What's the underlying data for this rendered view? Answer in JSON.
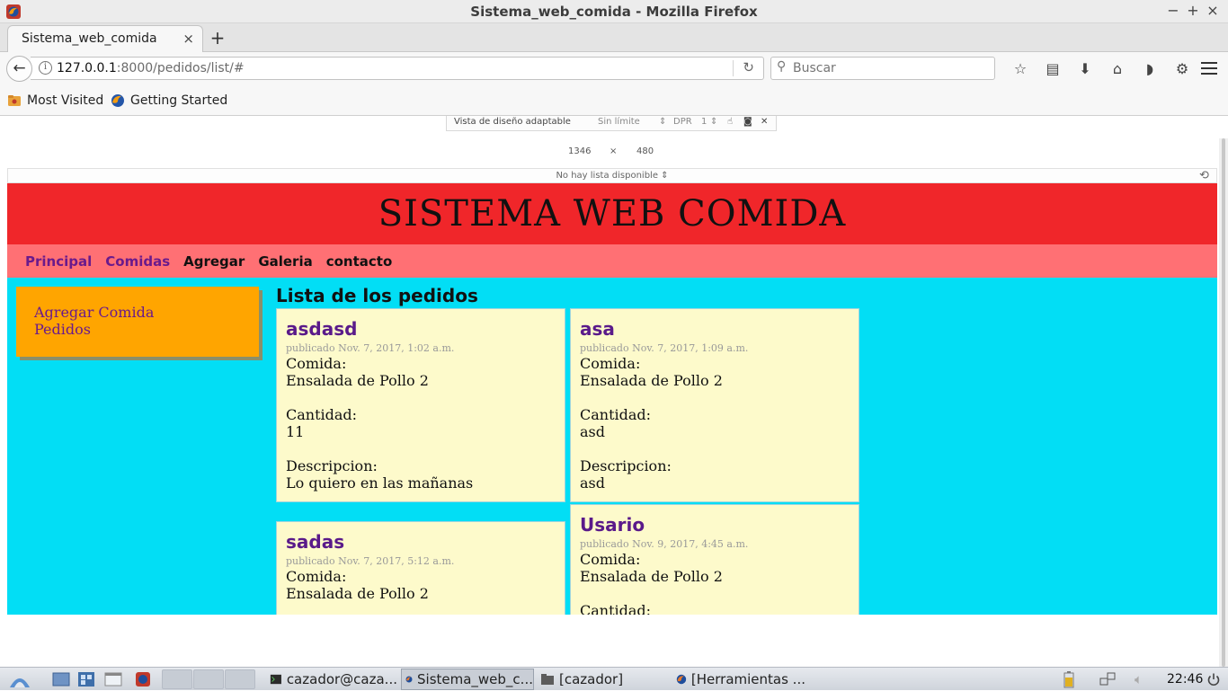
{
  "window": {
    "title": "Sistema_web_comida - Mozilla Firefox",
    "buttons": {
      "minimize": "−",
      "maximize": "+",
      "close": "×"
    }
  },
  "tab": {
    "label": "Sistema_web_comida",
    "close": "×",
    "new_tab": "+"
  },
  "urlbar": {
    "host": "127.0.0.1",
    "path": ":8000/pedidos/list/#"
  },
  "search": {
    "placeholder": "Buscar"
  },
  "bookmarks": [
    {
      "label": "Most Visited",
      "icon": "folder-icon"
    },
    {
      "label": "Getting Started",
      "icon": "firefox-icon"
    }
  ],
  "rdm": {
    "label": "Vista de diseño adaptable",
    "size_preset": "Sin límite",
    "dpr_label": "DPR",
    "dpr_value": "1",
    "width": "1346",
    "times": "×",
    "height": "480",
    "device": "No hay lista disponible"
  },
  "site": {
    "title": "SISTEMA WEB COMIDA",
    "nav": [
      {
        "label": "Principal",
        "style": "visited"
      },
      {
        "label": "Comidas",
        "style": "visited"
      },
      {
        "label": "Agregar",
        "style": "plain"
      },
      {
        "label": "Galeria",
        "style": "plain"
      },
      {
        "label": "contacto",
        "style": "plain"
      }
    ],
    "sidebar": [
      "Agregar Comida",
      "Pedidos"
    ],
    "heading": "Lista de los pedidos",
    "comida_label": "Comida:",
    "cantidad_label": "Cantidad:",
    "descripcion_label": "Descripcion:",
    "orders": [
      {
        "title": "asdasd",
        "published": "publicado Nov. 7, 2017, 1:02 a.m.",
        "comida": "Ensalada de Pollo 2",
        "cantidad": "11",
        "descripcion": "Lo quiero en las mañanas"
      },
      {
        "title": "asa",
        "published": "publicado Nov. 7, 2017, 1:09 a.m.",
        "comida": "Ensalada de Pollo 2",
        "cantidad": "asd",
        "descripcion": "asd"
      },
      {
        "title": "sadas",
        "published": "publicado Nov. 7, 2017, 5:12 a.m.",
        "comida": "Ensalada de Pollo 2"
      },
      {
        "title": "Usario",
        "published": "publicado Nov. 9, 2017, 4:45 a.m.",
        "comida": "Ensalada de Pollo 2"
      }
    ]
  },
  "taskbar": {
    "tasks": [
      {
        "label": "cazador@caza...",
        "icon": "terminal-icon"
      },
      {
        "label": "Sistema_web_c...",
        "icon": "firefox-icon"
      },
      {
        "label": "[cazador]",
        "icon": "folder-icon"
      },
      {
        "label": "[Herramientas ...",
        "icon": "firefox-icon"
      }
    ],
    "clock": "22:46"
  },
  "colors": {
    "header": "#f0262a",
    "nav": "#ff7074",
    "page_bg": "#02def5",
    "sidebar": "#ffa500",
    "card": "#fdfacb",
    "link": "#6a1a8c"
  }
}
